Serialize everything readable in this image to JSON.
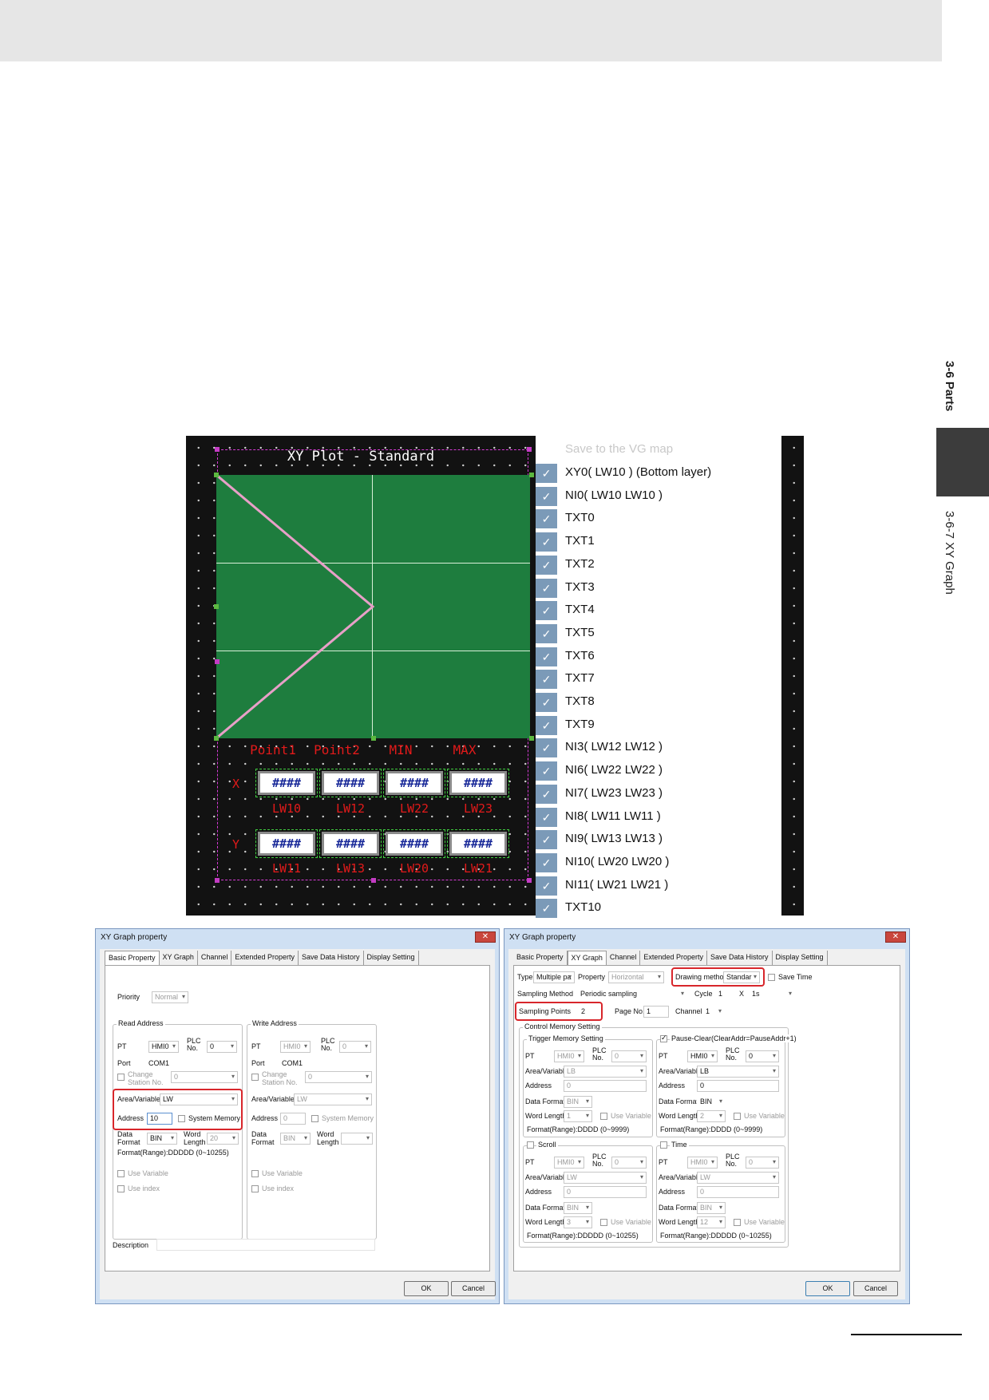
{
  "side": {
    "section": "3-6 Parts",
    "subsection": "3-6-7 XY Graph"
  },
  "editor": {
    "title": "XY Plot - Standard",
    "headers": [
      "Point1",
      "Point2",
      "MIN",
      "MAX"
    ],
    "row_x": "X",
    "row_y": "Y",
    "placeholder": "####",
    "x_addresses": [
      "LW10",
      "LW12",
      "LW22",
      "LW23"
    ],
    "y_addresses": [
      "LW11",
      "LW13",
      "LW20",
      "LW21"
    ]
  },
  "layers": {
    "header": "Save to the VG map",
    "items": [
      "XY0( LW10 ) (Bottom layer)",
      "NI0( LW10 LW10 )",
      "TXT0",
      "TXT1",
      "TXT2",
      "TXT3",
      "TXT4",
      "TXT5",
      "TXT6",
      "TXT7",
      "TXT8",
      "TXT9",
      "NI3( LW12 LW12 )",
      "NI6( LW22 LW22 )",
      "NI7( LW23 LW23 )",
      "NI8( LW11 LW11 )",
      "NI9( LW13 LW13 )",
      "NI10( LW20 LW20 )",
      "NI11( LW21 LW21 )",
      "TXT10"
    ]
  },
  "dialog_left": {
    "title": "XY Graph property",
    "tabs": [
      "Basic Property",
      "XY Graph",
      "Channel",
      "Extended Property",
      "Save Data History",
      "Display Setting"
    ],
    "priority_label": "Priority",
    "priority_value": "Normal",
    "read_title": "Read Address",
    "write_title": "Write Address",
    "pt": "PT",
    "pt_value": "HMI0",
    "plc_no": "PLC No.",
    "plc_value": "0",
    "port": "Port",
    "port_value": "COM1",
    "change_station": "Change Station No.",
    "station_value": "0",
    "area": "Area/Variable",
    "area_value": "LW",
    "address": "Address",
    "address_value": "10",
    "write_address_value": "0",
    "system_memory": "System Memory",
    "data_format": "Data Format",
    "format_value": "BIN",
    "word_length": "Word Length",
    "word_length_value": "20",
    "range": "Format(Range):DDDDD (0~10255)",
    "use_variable": "Use Variable",
    "use_index": "Use index",
    "description": "Description",
    "ok": "OK",
    "cancel": "Cancel"
  },
  "dialog_right": {
    "title": "XY Graph property",
    "type_label": "Type",
    "type_value": "Multiple pa",
    "property_label": "Property",
    "property_value": "Horizontal",
    "drawing_method": "Drawing method",
    "drawing_value": "Standar",
    "save_time": "Save Time",
    "sampling_method": "Sampling Method",
    "sampling_value": "Periodic sampling",
    "cycle": "Cycle",
    "cycle_value": "1",
    "x": "X",
    "cycle_unit": "1s",
    "sampling_points": "Sampling Points",
    "sampling_points_value": "2",
    "page_no": "Page No.",
    "page_value": "1",
    "channel": "Channel",
    "channel_value": "1",
    "control_memory": "Control Memory Setting",
    "trigger_memory": "Trigger Memory Setting",
    "pause_clear": "Pause-Clear(ClearAddr=PauseAddr+1)",
    "scroll": "Scroll",
    "time": "Time",
    "pt_value": "HMI0",
    "plc_value": "0",
    "lb": "LB",
    "lw": "LW",
    "zero": "0",
    "bin": "BIN",
    "len1": "1",
    "len2": "2",
    "len3": "3",
    "len12": "12",
    "range4": "Format(Range):DDDD (0~9999)",
    "range5": "Format(Range):DDDDD (0~10255)",
    "pt": "PT",
    "plc_no": "PLC No.",
    "area": "Area/Variable",
    "address": "Address",
    "data_format": "Data Format",
    "word_length": "Word Length",
    "use_variable": "Use Variable",
    "ok": "OK",
    "cancel": "Cancel"
  }
}
